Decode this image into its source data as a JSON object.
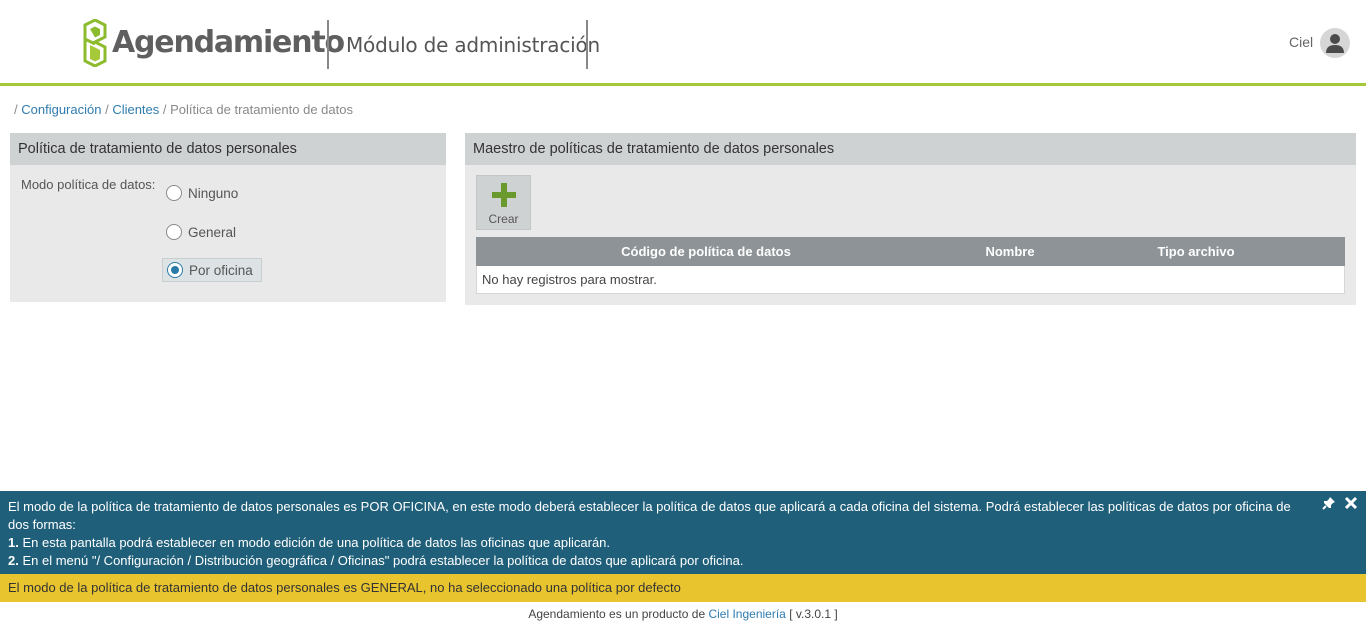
{
  "header": {
    "logo_text": "Agendamiento",
    "module_title": "Módulo de administración",
    "user_name": "Ciel",
    "accent_color": "#a6c93a"
  },
  "breadcrumb": {
    "items": [
      "Configuración",
      "Clientes",
      "Política de tratamiento de datos"
    ]
  },
  "left_panel": {
    "title": "Política de tratamiento de datos personales",
    "mode_label": "Modo política de datos:",
    "options": [
      {
        "label": "Ninguno",
        "selected": false
      },
      {
        "label": "General",
        "selected": false
      },
      {
        "label": "Por oficina",
        "selected": true
      }
    ]
  },
  "right_panel": {
    "title": "Maestro de políticas de tratamiento de datos personales",
    "create_label": "Crear",
    "columns": [
      "Código de política de datos",
      "Nombre",
      "Tipo archivo"
    ],
    "empty_message": "No hay registros para mostrar."
  },
  "notices": {
    "blue_line1": "El modo de la política de tratamiento de datos personales es POR OFICINA, en este modo deberá establecer la política de datos que aplicará a cada oficina del sistema. Podrá establecer las políticas de datos por oficina de dos formas:",
    "blue_item1_num": "1.",
    "blue_item1": "En esta pantalla podrá establecer en modo edición de una política de datos las oficinas que aplicarán.",
    "blue_item2_num": "2.",
    "blue_item2": "En el menú \"/ Configuración / Distribución geográfica / Oficinas\" podrá establecer la política de datos que aplicará por oficina.",
    "yellow": "El modo de la política de tratamiento de datos personales es GENERAL, no ha seleccionado una política por defecto",
    "blue_color": "#1f5f7a",
    "yellow_color": "#e8c42f"
  },
  "footer": {
    "prefix": "Agendamiento es un producto de",
    "company": "Ciel Ingeniería",
    "version": "[ v.3.0.1 ]"
  }
}
